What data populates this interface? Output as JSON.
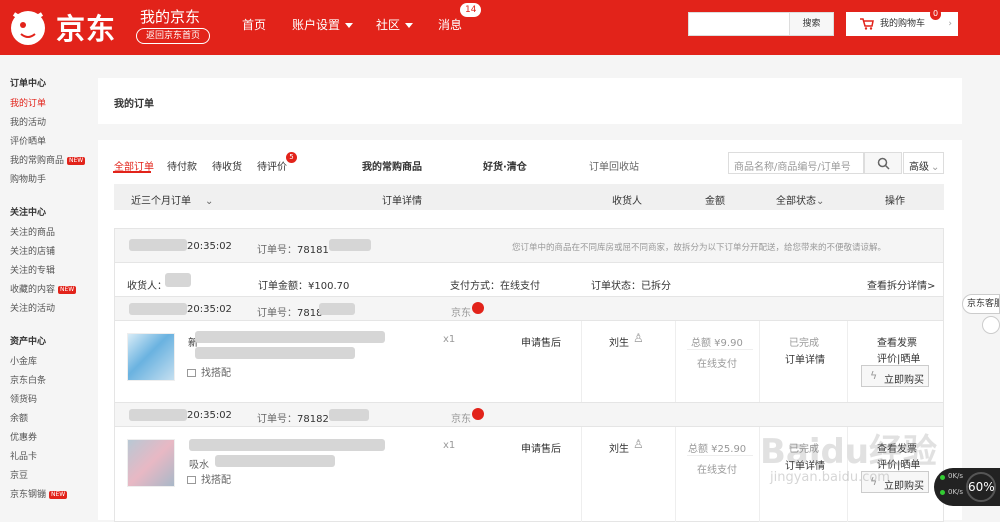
{
  "header": {
    "logo_text": "京东",
    "my_jd": "我的京东",
    "back_home": "返回京东首页",
    "nav": [
      "首页",
      "账户设置",
      "社区",
      "消息"
    ],
    "message_count": "14",
    "search_button": "搜索",
    "cart_label": "我的购物车",
    "cart_count": "0"
  },
  "sidebar": {
    "sections": [
      {
        "title": "订单中心",
        "items": [
          "我的订单",
          "我的活动",
          "评价晒单",
          "我的常购商品",
          "购物助手"
        ]
      },
      {
        "title": "关注中心",
        "items": [
          "关注的商品",
          "关注的店铺",
          "关注的专辑",
          "收藏的内容",
          "关注的活动"
        ]
      },
      {
        "title": "资产中心",
        "items": [
          "小金库",
          "京东白条",
          "领货码",
          "余额",
          "优惠券",
          "礼品卡",
          "京豆",
          "京东钢镚"
        ]
      }
    ],
    "new_badge": "NEW"
  },
  "page_title": "我的订单",
  "tabs": {
    "all": "全部订单",
    "pending_pay": "待付款",
    "pending_receive": "待收货",
    "pending_review": "待评价",
    "review_count": "5",
    "frequent": "我的常购商品",
    "good_clear": "好货·清仓",
    "recycle": "订单回收站",
    "search_placeholder": "商品名称/商品编号/订单号",
    "advanced": "高级"
  },
  "table_header": {
    "period": "近三个月订单",
    "detail": "订单详情",
    "receiver": "收货人",
    "amount": "金额",
    "status": "全部状态",
    "action": "操作"
  },
  "parent_order": {
    "time": "20:35:02",
    "order_label": "订单号：",
    "order_no": "78181",
    "split_notice": "您订单中的商品在不同库房或屈不同商家，故拆分为以下订单分开配送，给您带来的不便敬请谅解。",
    "receiver_label": "收货人：",
    "amount_text": "订单金额：¥100.70",
    "payment": "支付方式：在线支付",
    "status": "订单状态：已拆分",
    "split_detail": "查看拆分详情>"
  },
  "orders": [
    {
      "time": "20:35:02",
      "order_label": "订单号：",
      "order_no": "7818",
      "shop": "京东",
      "item_name_prefix": "新",
      "match": "找搭配",
      "qty": "x1",
      "aftersale": "申请售后",
      "receiver": "刘生",
      "total": "总额 ¥9.90",
      "pay": "在线支付",
      "status": "已完成",
      "detail": "订单详情",
      "invoice": "查看发票",
      "review": "评价|晒单",
      "rebuy": "立即购买"
    },
    {
      "time": "20:35:02",
      "order_label": "订单号：",
      "order_no": "78182",
      "shop": "京东",
      "item_name_prefix": "吸水",
      "match": "找搭配",
      "qty": "x1",
      "aftersale": "申请售后",
      "receiver": "刘生",
      "total": "总额 ¥25.90",
      "pay": "在线支付",
      "status": "已完成",
      "detail": "订单详情",
      "invoice": "查看发票",
      "review": "评价|晒单",
      "rebuy": "立即购买"
    }
  ],
  "overlay": {
    "service_label": "京东客服",
    "watermark_line1": "Baidu经验",
    "watermark_line2": "jingyan.baidu.com",
    "speed_up": "0K/s",
    "speed_down": "0K/s",
    "percent": "60%"
  }
}
